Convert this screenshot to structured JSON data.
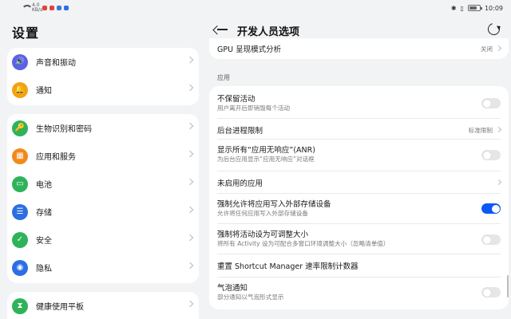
{
  "status_bar": {
    "net_speed": "4.0 KB/s",
    "time": "10:09",
    "app_dot_colors": [
      "#e0443a",
      "#e0443a",
      "#3a7bd5",
      "#2f6fe0"
    ]
  },
  "left": {
    "title": "设置",
    "groups": [
      [
        {
          "label": "声音和振动",
          "icon": "speaker-icon",
          "color": "#5b61e8",
          "glyph": "🔊"
        },
        {
          "label": "通知",
          "icon": "bell-icon",
          "color": "#f2a213",
          "glyph": "🔔"
        }
      ],
      [
        {
          "label": "生物识别和密码",
          "icon": "key-icon",
          "color": "#2eb35a",
          "glyph": "🔑"
        },
        {
          "label": "应用和服务",
          "icon": "apps-icon",
          "color": "#f08a1c",
          "glyph": "▦"
        },
        {
          "label": "电池",
          "icon": "battery-icon",
          "color": "#2eb35a",
          "glyph": "▭"
        },
        {
          "label": "存储",
          "icon": "storage-icon",
          "color": "#2b6fe3",
          "glyph": "☰"
        },
        {
          "label": "安全",
          "icon": "shield-check-icon",
          "color": "#2eb35a",
          "glyph": "✓"
        },
        {
          "label": "隐私",
          "icon": "privacy-icon",
          "color": "#2b6fe3",
          "glyph": "◉"
        }
      ],
      [
        {
          "label": "健康使用平板",
          "icon": "hourglass-icon",
          "color": "#2eb35a",
          "glyph": "⧗"
        }
      ]
    ]
  },
  "right": {
    "title": "开发人员选项",
    "gpu_row": {
      "title": "GPU 呈现模式分析",
      "value": "关闭"
    },
    "section_label": "应用",
    "rows": [
      {
        "title": "不保留活动",
        "subtitle": "用户离开后即销毁每个活动",
        "control": "toggle",
        "on": false
      },
      {
        "title": "后台进程限制",
        "value": "标准限制",
        "control": "chevron"
      },
      {
        "title": "显示所有“应用无响应”(ANR)",
        "subtitle": "为后台应用显示“应用无响应”对话框",
        "control": "toggle",
        "on": false
      },
      {
        "title": "未启用的应用",
        "control": "chevron"
      },
      {
        "title": "强制允许将应用写入外部存储设备",
        "subtitle": "允许将任何应用写入外部存储设备",
        "control": "toggle",
        "on": true
      },
      {
        "title": "强制将活动设为可调整大小",
        "subtitle": "将所有 Activity 设为可配合多窗口环境调整大小（忽略清单值）",
        "control": "toggle",
        "on": false
      },
      {
        "title": "重置 Shortcut Manager 速率限制计数器",
        "control": "none"
      },
      {
        "title": "气泡通知",
        "subtitle": "部分通知以气泡形式显示",
        "control": "toggle",
        "on": false
      }
    ]
  }
}
